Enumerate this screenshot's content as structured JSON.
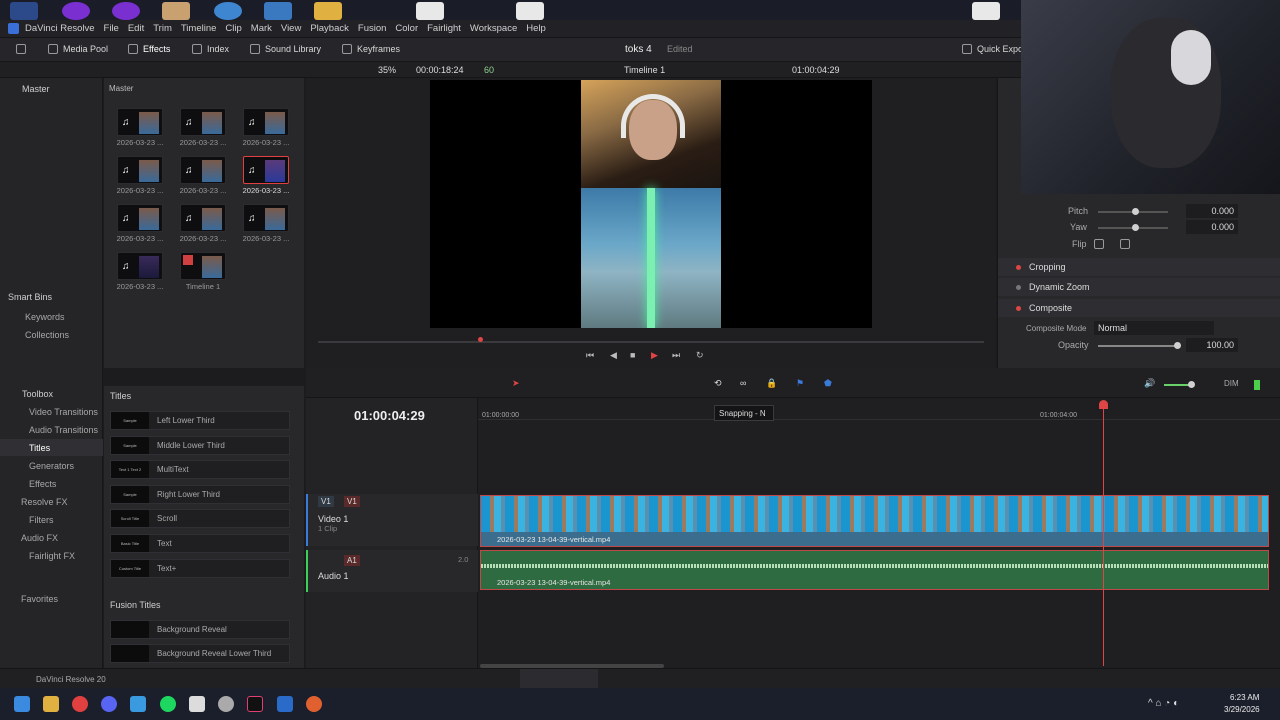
{
  "app": {
    "name": "DaVinci Resolve"
  },
  "menu": [
    "File",
    "Edit",
    "Trim",
    "Timeline",
    "Clip",
    "Mark",
    "View",
    "Playback",
    "Fusion",
    "Color",
    "Fairlight",
    "Workspace",
    "Help"
  ],
  "toolbar": {
    "media_pool": "Media Pool",
    "effects": "Effects",
    "index": "Index",
    "sound_library": "Sound Library",
    "keyframes": "Keyframes",
    "project": "toks 4",
    "project_status": "Edited",
    "quick_export": "Quick Export"
  },
  "viewer_bar": {
    "zoom": "35%",
    "source_tc": "00:00:18:24",
    "fps": "60",
    "timeline_name": "Timeline 1",
    "record_tc": "01:00:04:29"
  },
  "media_pool": {
    "bin": "Master",
    "bin_header": "Master",
    "clips": [
      "2026-03-23 ...",
      "2026-03-23 ...",
      "2026-03-23 ...",
      "2026-03-23 ...",
      "2026-03-23 ...",
      "2026-03-23 ...",
      "2026-03-23 ...",
      "2026-03-23 ...",
      "2026-03-23 ...",
      "2026-03-23 ...",
      "Timeline 1"
    ],
    "smart_bins": "Smart Bins",
    "keywords": "Keywords",
    "collections": "Collections"
  },
  "inspector": {
    "pitch_label": "Pitch",
    "pitch": "0.000",
    "yaw_label": "Yaw",
    "yaw": "0.000",
    "flip": "Flip",
    "cropping": "Cropping",
    "dynamic_zoom": "Dynamic Zoom",
    "composite": "Composite",
    "composite_mode_label": "Composite Mode",
    "composite_mode": "Normal",
    "opacity_label": "Opacity",
    "opacity": "100.00"
  },
  "effects": {
    "toolbox": "Toolbox",
    "categories": [
      "Video Transitions",
      "Audio Transitions",
      "Titles",
      "Generators",
      "Effects",
      "Resolve FX",
      "Filters",
      "Audio FX",
      "Fairlight FX",
      "Favorites"
    ],
    "titles_header": "Titles",
    "titles": [
      "Left Lower Third",
      "Middle Lower Third",
      "MultiText",
      "Right Lower Third",
      "Scroll",
      "Text",
      "Text+"
    ],
    "title_thumbs": [
      "Sample",
      "Sample",
      "Text 1 Text 2",
      "Sample",
      "Scroll Title",
      "Basic Title",
      "Custom Title"
    ],
    "fusion_header": "Fusion Titles",
    "fusion_titles": [
      "Background Reveal",
      "Background Reveal Lower Third"
    ]
  },
  "timeline": {
    "timecode": "01:00:04:29",
    "ruler_start": "01:00:00:00",
    "ruler_mark": "01:00:04:00",
    "v1": "V1",
    "video_track": "Video 1",
    "clip_count": "1 Clip",
    "a1": "A1",
    "audio_track": "Audio 1",
    "audio_level": "2.0",
    "video_clip": "2026-03-23 13-04-39-vertical.mp4",
    "audio_clip": "2026-03-23 13-04-39-vertical.mp4",
    "tooltip": "Snapping - N",
    "dim": "DIM"
  },
  "taskbar": {
    "time": "6:23 AM",
    "date": "3/29/2026",
    "running": "DaVinci Resolve 20"
  }
}
